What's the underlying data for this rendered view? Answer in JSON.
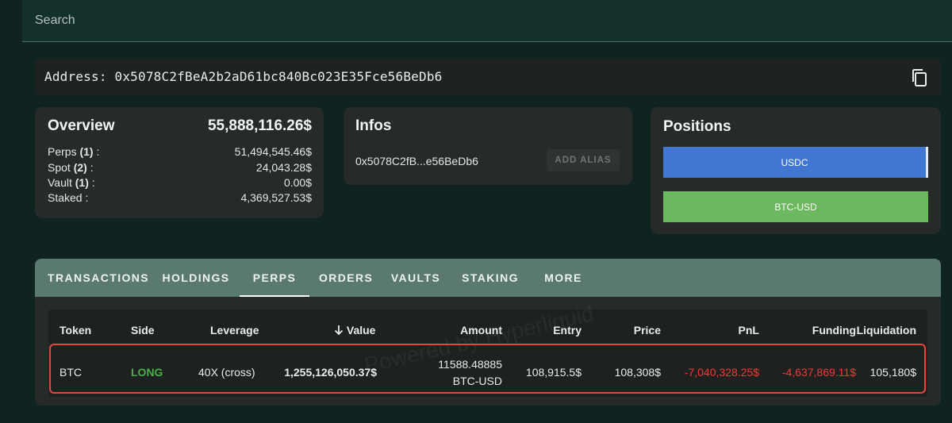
{
  "search": {
    "placeholder": "Search"
  },
  "address": {
    "label": "Address:",
    "value": "0x5078C2fBeA2b2aD61bc840Bc023E35Fce56BeDb6"
  },
  "overview": {
    "title": "Overview",
    "total": "55,888,116.26$",
    "rows": [
      {
        "name": "Perps",
        "count": "(1)",
        "suffix": " :",
        "value": "51,494,545.46$"
      },
      {
        "name": "Spot",
        "count": "(2)",
        "suffix": " :",
        "value": "24,043.28$"
      },
      {
        "name": "Vault",
        "count": "(1)",
        "suffix": " :",
        "value": "0.00$"
      },
      {
        "name": "Staked",
        "count": "",
        "suffix": " :",
        "value": "4,369,527.53$"
      }
    ]
  },
  "infos": {
    "title": "Infos",
    "short_address": "0x5078C2fB...e56BeDb6",
    "alias_button": "ADD ALIAS"
  },
  "positions": {
    "title": "Positions",
    "bars": [
      "USDC",
      "BTC-USD"
    ]
  },
  "tabs": [
    "TRANSACTIONS",
    "HOLDINGS",
    "PERPS",
    "ORDERS",
    "VAULTS",
    "STAKING",
    "MORE"
  ],
  "active_tab": "PERPS",
  "table": {
    "headers": [
      "Token",
      "Side",
      "Leverage",
      "Value",
      "Amount",
      "Entry",
      "Price",
      "PnL",
      "Funding",
      "Liquidation"
    ],
    "sort_icon": "arrow-down-icon",
    "rows": [
      {
        "token": "BTC",
        "side": "LONG",
        "leverage": "40X (cross)",
        "value": "1,255,126,050.37$",
        "amount": "11588.48885",
        "amount_unit": "BTC-USD",
        "entry": "108,915.5$",
        "price": "108,308$",
        "pnl": "-7,040,328.25$",
        "funding": "-4,637,869.11$",
        "liquidation": "105,180$"
      }
    ]
  },
  "watermark": "Powered by Hyperliquid",
  "colors": {
    "long": "#4cb04a",
    "negative": "#f03a3a",
    "usdc_bar": "#4176d3",
    "btc_bar": "#6bb85e",
    "tab_bar": "#5a7a6f",
    "highlight": "#e8463b"
  }
}
